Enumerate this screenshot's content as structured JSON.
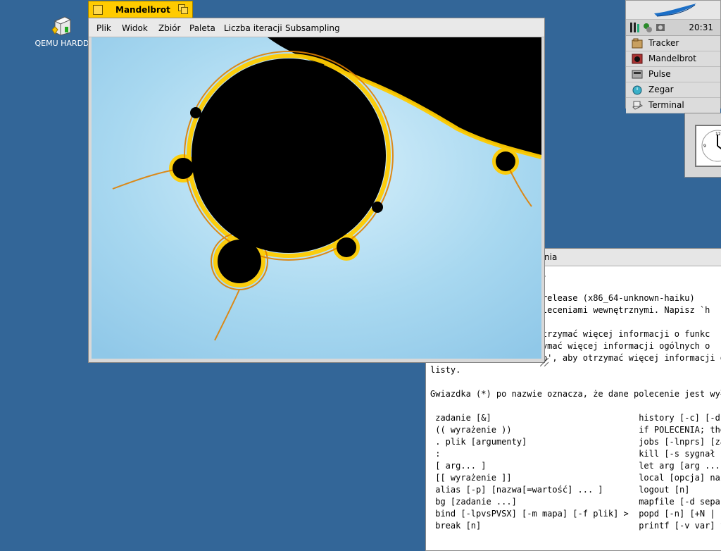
{
  "desktop": {
    "icons": [
      {
        "label": "QEMU HARDD",
        "icon": "hard-disk-icon"
      }
    ]
  },
  "deskbar": {
    "clock": "20:31",
    "items": [
      {
        "label": "Tracker",
        "icon": "tracker-icon"
      },
      {
        "label": "Mandelbrot",
        "icon": "mandelbrot-icon"
      },
      {
        "label": "Pulse",
        "icon": "pulse-icon"
      },
      {
        "label": "Zegar",
        "icon": "clock-icon"
      },
      {
        "label": "Terminal",
        "icon": "terminal-icon"
      }
    ]
  },
  "mandelbrot": {
    "title": "Mandelbrot",
    "menu": [
      "Plik",
      "Widok",
      "Zbiór",
      "Paleta",
      "Liczba iteracji",
      "Subsampling"
    ],
    "colors": {
      "background": "#b0dcf0",
      "set": "#000000",
      "edge": "#ffcc00"
    }
  },
  "terminal": {
    "title_visible": "nia",
    "lines": [
      "                   ell.",
      "",
      "                   1)-release (x86_64-unknown-haiku)",
      "                    poleceniami wewnętrznymi. Napisz `h",
      "",
      "                   y otrzymać więcej informacji o funkc",
      "                   trzymać więcej informacji ogólnych o",
      "Użyj `man -k' lub `info', aby otrzymać więcej informacji o",
      "listy.",
      "",
      "Gwiazdka (*) po nazwie oznacza, że dane polecenie jest wyłą",
      "",
      " zadanie [&]                             history [-c] [-d o",
      " (( wyrażenie ))                         if POLECENIA; then",
      " . plik [argumenty]                      jobs [-lnprs] [zad",
      " :                                       kill [-s sygnał |",
      " [ arg... ]                              let arg [arg ...]",
      " [[ wyrażenie ]]                         local [opcja] nazw",
      " alias [-p] [nazwa[=wartość] ... ]       logout [n]",
      " bg [zadanie ...]                        mapfile [-d separa",
      " bind [-lpvsPVSX] [-m mapa] [-f plik] >  popd [-n] [+N | -N",
      " break [n]                               printf [-v var] fo"
    ]
  }
}
